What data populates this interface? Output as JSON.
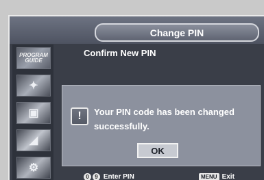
{
  "header": {
    "title": "Change PIN"
  },
  "sidebar": {
    "items": [
      {
        "name": "program-guide",
        "label": "PROGRAM GUIDE",
        "icon": "program-guide-icon"
      },
      {
        "name": "channel",
        "icon": "channel-icon"
      },
      {
        "name": "picture",
        "icon": "picture-icon"
      },
      {
        "name": "sound",
        "icon": "sound-icon"
      },
      {
        "name": "setup",
        "icon": "setup-icon"
      }
    ]
  },
  "main": {
    "heading": "Confirm New PIN"
  },
  "dialog": {
    "icon": "exclamation-icon",
    "message": "Your PIN code has been changed successfully.",
    "ok_label": "OK"
  },
  "footer": {
    "enter_label": "Enter PIN",
    "menu_key": "MENU",
    "exit_label": "Exit"
  }
}
